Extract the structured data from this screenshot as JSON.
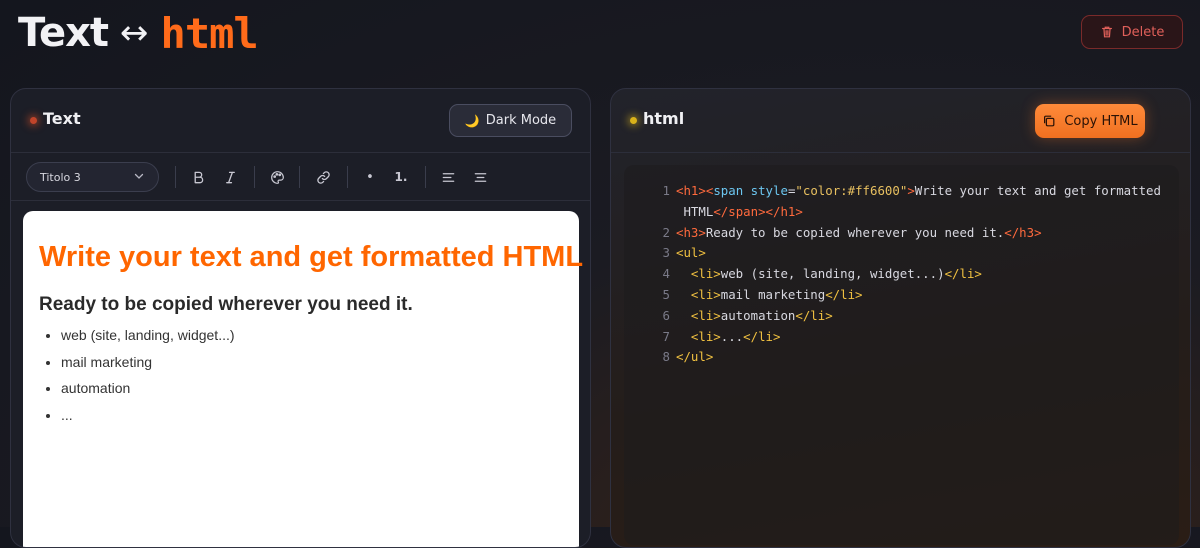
{
  "header": {
    "logo_text": "Text",
    "logo_arrow": "↔",
    "logo_html": "html",
    "delete_label": "Delete"
  },
  "left_panel": {
    "title": "Text",
    "dark_mode_label": "Dark Mode",
    "toolbar": {
      "heading_select": "Titolo 3",
      "buttons": [
        "bold",
        "italic",
        "text-color",
        "link",
        "bullet-list",
        "numbered-list",
        "align-left",
        "align-center"
      ],
      "ordered_label": "1.",
      "bullet_label": "•"
    },
    "editor": {
      "h1": "Write your text and get formatted HTML",
      "h1_color": "#ff6600",
      "h3": "Ready to be copied wherever you need it.",
      "list": [
        "web (site, landing, widget...)",
        "mail marketing",
        "automation",
        "..."
      ]
    }
  },
  "right_panel": {
    "title": "html",
    "copy_label": "Copy HTML",
    "code_lines": [
      {
        "n": "1",
        "parts": [
          [
            "tag",
            "<h1>"
          ],
          [
            "tag",
            "<"
          ],
          [
            "attr",
            "span"
          ],
          [
            "plain",
            " "
          ],
          [
            "attr",
            "style"
          ],
          [
            "plain",
            "="
          ],
          [
            "str",
            "\"color:#ff6600\""
          ],
          [
            "tag",
            ">"
          ],
          [
            "plain",
            "Write your text and get formatted"
          ]
        ]
      },
      {
        "n": "",
        "parts": [
          [
            "plain",
            " HTML"
          ],
          [
            "tag",
            "</span>"
          ],
          [
            "tag",
            "</h1>"
          ]
        ]
      },
      {
        "n": "2",
        "parts": [
          [
            "tag",
            "<h3>"
          ],
          [
            "plain",
            "Ready to be copied wherever you need it."
          ],
          [
            "tag",
            "</h3>"
          ]
        ]
      },
      {
        "n": "3",
        "parts": [
          [
            "tag2",
            "<ul>"
          ]
        ]
      },
      {
        "n": "4",
        "parts": [
          [
            "plain",
            "  "
          ],
          [
            "tag2",
            "<li>"
          ],
          [
            "plain",
            "web (site, landing, widget...)"
          ],
          [
            "tag2",
            "</li>"
          ]
        ]
      },
      {
        "n": "5",
        "parts": [
          [
            "plain",
            "  "
          ],
          [
            "tag2",
            "<li>"
          ],
          [
            "plain",
            "mail marketing"
          ],
          [
            "tag2",
            "</li>"
          ]
        ]
      },
      {
        "n": "6",
        "parts": [
          [
            "plain",
            "  "
          ],
          [
            "tag2",
            "<li>"
          ],
          [
            "plain",
            "automation"
          ],
          [
            "tag2",
            "</li>"
          ]
        ]
      },
      {
        "n": "7",
        "parts": [
          [
            "plain",
            "  "
          ],
          [
            "tag2",
            "<li>"
          ],
          [
            "plain",
            "..."
          ],
          [
            "tag2",
            "</li>"
          ]
        ]
      },
      {
        "n": "8",
        "parts": [
          [
            "tag2",
            "</ul>"
          ]
        ]
      }
    ]
  }
}
